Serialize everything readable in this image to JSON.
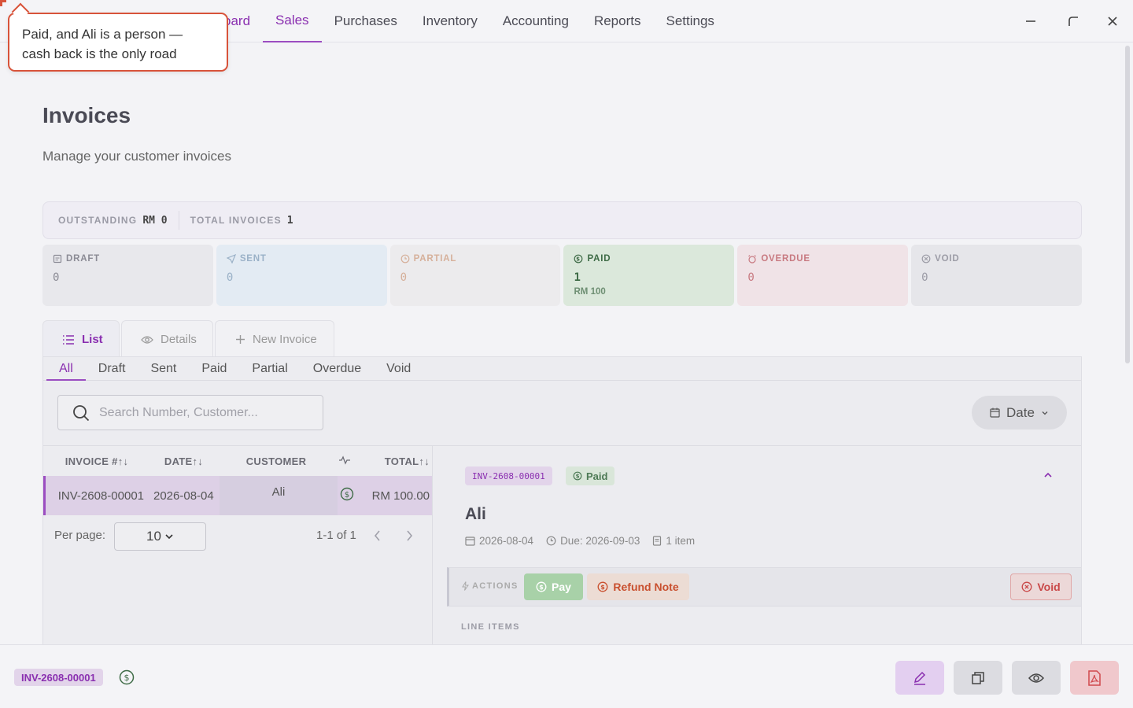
{
  "nav": {
    "items": [
      {
        "label": "oard"
      },
      {
        "label": "Sales"
      },
      {
        "label": "Purchases"
      },
      {
        "label": "Inventory"
      },
      {
        "label": "Accounting"
      },
      {
        "label": "Reports"
      },
      {
        "label": "Settings"
      }
    ]
  },
  "tooltip": {
    "line1": "Paid, and Ali is a person —",
    "line2": "cash back is the only road"
  },
  "page": {
    "title": "Invoices",
    "subtitle": "Manage your customer invoices"
  },
  "summary": {
    "outstanding_label": "OUTSTANDING",
    "outstanding_value": "RM 0",
    "total_label": "TOTAL INVOICES",
    "total_value": "1"
  },
  "cards": [
    {
      "label": "DRAFT",
      "count": "0",
      "icon": "draft-icon"
    },
    {
      "label": "SENT",
      "count": "0",
      "icon": "send-icon"
    },
    {
      "label": "PARTIAL",
      "count": "0",
      "icon": "clock-icon"
    },
    {
      "label": "PAID",
      "count": "1",
      "amount": "RM 100",
      "icon": "dollar-icon"
    },
    {
      "label": "OVERDUE",
      "count": "0",
      "icon": "alarm-icon"
    },
    {
      "label": "VOID",
      "count": "0",
      "icon": "x-circle-icon"
    }
  ],
  "view_tabs": {
    "list": "List",
    "details": "Details",
    "new_invoice": "New Invoice"
  },
  "filter_tabs": [
    "All",
    "Draft",
    "Sent",
    "Paid",
    "Partial",
    "Overdue",
    "Void"
  ],
  "search": {
    "placeholder": "Search Number, Customer..."
  },
  "date_button": "Date",
  "table": {
    "headers": {
      "invoice": "INVOICE #",
      "date": "DATE",
      "customer": "CUSTOMER",
      "total": "TOTAL"
    },
    "rows": [
      {
        "invoice": "INV-2608-00001",
        "date": "2026-08-04",
        "customer": "Ali",
        "total": "RM 100.00"
      }
    ]
  },
  "pager": {
    "per_page_label": "Per page:",
    "per_page_value": "10",
    "range": "1-1 of 1"
  },
  "detail": {
    "number": "INV-2608-00001",
    "status": "Paid",
    "customer": "Ali",
    "date": "2026-08-04",
    "due": "Due: 2026-09-03",
    "items": "1 item",
    "actions_label": "ACTIONS",
    "pay": "Pay",
    "refund": "Refund Note",
    "void": "Void",
    "line_items_label": "LINE ITEMS"
  },
  "bottom": {
    "number": "INV-2608-00001"
  },
  "colors": {
    "accent": "#8a2fb0",
    "paid": "#3e6b46",
    "danger": "#c94848",
    "refund": "#c9502f"
  }
}
